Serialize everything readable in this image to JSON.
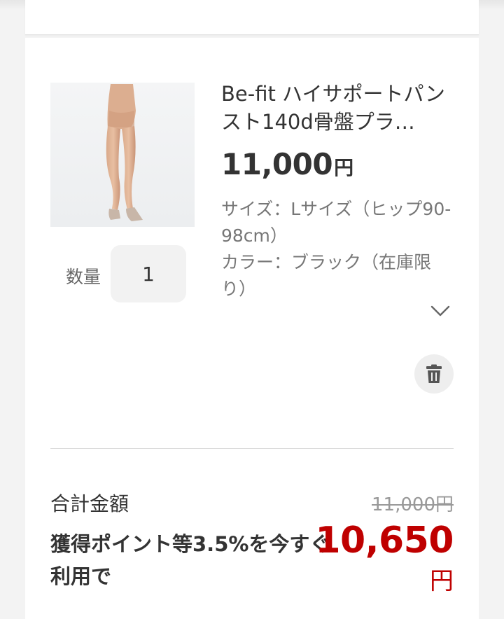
{
  "product": {
    "title": "Be-fit ハイサポートパンスト140d骨盤プラ…",
    "price": "11,000",
    "currency": "円",
    "options": [
      "サイズ：Lサイズ（ヒップ90-98cm）",
      "カラー：ブラック（在庫限り）"
    ],
    "quantity_label": "数量",
    "quantity": "1",
    "image_icon": "pantyhose-product-image",
    "expand_icon": "chevron-down-icon",
    "delete_icon": "trash-icon"
  },
  "summary": {
    "total_label": "合計金額",
    "original_price": "11,000円",
    "promo_text": "獲得ポイント等3.5%を今すぐ利用で",
    "final_price": "10,650",
    "final_currency": "円"
  },
  "colors": {
    "accent_red": "#bf0000",
    "text": "#333333",
    "muted": "#777777"
  }
}
